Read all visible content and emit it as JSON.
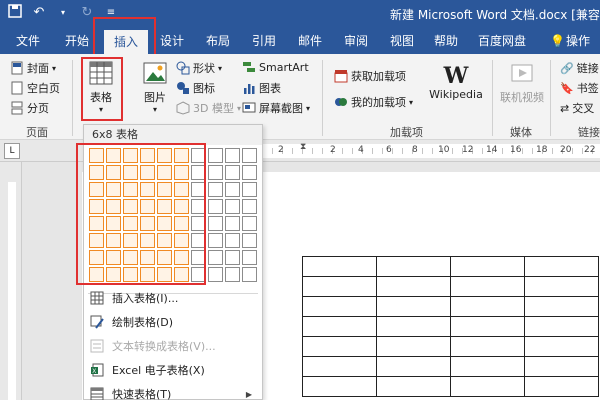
{
  "titlebar": {
    "title": "新建 Microsoft Word 文档.docx [兼容模式"
  },
  "qat": {
    "save_icon": "save-icon",
    "undo_icon": "undo-icon",
    "redo_icon": "redo-icon",
    "customize_icon": "dropdown-icon"
  },
  "tabs": [
    "文件",
    "开始",
    "插入",
    "设计",
    "布局",
    "引用",
    "邮件",
    "审阅",
    "视图",
    "帮助",
    "百度网盘",
    "操作说"
  ],
  "ribbon": {
    "pages": {
      "cover": "封面",
      "blank": "空白页",
      "break": "分页",
      "group_label": "页面"
    },
    "table": {
      "label": "表格"
    },
    "illustrations": {
      "picture": "图片",
      "shapes": "形状",
      "icons": "图标",
      "model3d": "3D 模型",
      "smartart": "SmartArt",
      "chart": "图表",
      "screenshot": "屏幕截图"
    },
    "addins": {
      "get": "获取加载项",
      "my": "我的加载项",
      "wikipedia": "Wikipedia",
      "group_label": "加载项"
    },
    "media": {
      "online_video": "联机视频",
      "group_label": "媒体"
    },
    "links": {
      "link": "链接",
      "bookmark": "书签",
      "cross_ref": "交叉",
      "group_label": "链接"
    }
  },
  "ruler": {
    "numbers": [
      "2",
      "2",
      "4",
      "6",
      "8",
      "10",
      "12",
      "14",
      "16",
      "18",
      "20",
      "22"
    ]
  },
  "dropdown": {
    "header": "6x8 表格",
    "grid": {
      "cols": 10,
      "rows": 8,
      "selected_cols": 6,
      "selected_rows": 8
    },
    "items": [
      {
        "label": "插入表格(I)...",
        "disabled": false
      },
      {
        "label": "绘制表格(D)",
        "disabled": false
      },
      {
        "label": "文本转换成表格(V)...",
        "disabled": true
      },
      {
        "label": "Excel 电子表格(X)",
        "disabled": false
      },
      {
        "label": "快速表格(T)",
        "disabled": false,
        "submenu": true
      }
    ]
  },
  "colors": {
    "titlebar": "#2b579a",
    "highlight": "#e03030",
    "grid_selected": "#f08a24"
  }
}
